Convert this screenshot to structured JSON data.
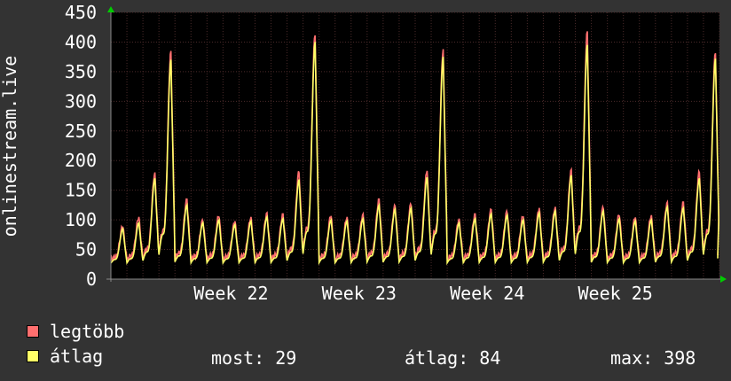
{
  "chart_data": {
    "type": "line",
    "ylabel": "onlinestream.live",
    "ylim": [
      0,
      450
    ],
    "y_ticks": [
      0,
      50,
      100,
      150,
      200,
      250,
      300,
      350,
      400,
      450
    ],
    "x_tick_labels": [
      "Week 22",
      "Week 23",
      "Week 24",
      "Week 25"
    ],
    "grid": true,
    "colors": {
      "background": "#333333",
      "plot": "#000000",
      "grid": "#4a2a2a",
      "axis": "#888888",
      "max": "#ff6f6f",
      "avg": "#ffff66",
      "arrow": "#00cc00"
    },
    "series": [
      {
        "name": "legtöbb",
        "color": "#ff6f6f"
      },
      {
        "name": "átlag",
        "color": "#ffff66"
      }
    ],
    "daily_peaks": [
      {
        "day": 0,
        "max": 90,
        "avg": 85
      },
      {
        "day": 1,
        "max": 105,
        "avg": 95
      },
      {
        "day": 2,
        "max": 180,
        "avg": 170
      },
      {
        "day": 3,
        "max": 385,
        "avg": 370
      },
      {
        "day": 4,
        "max": 135,
        "avg": 125
      },
      {
        "day": 5,
        "max": 100,
        "avg": 95
      },
      {
        "day": 6,
        "max": 108,
        "avg": 100
      },
      {
        "day": 7,
        "max": 98,
        "avg": 92
      },
      {
        "day": 8,
        "max": 105,
        "avg": 98
      },
      {
        "day": 9,
        "max": 112,
        "avg": 105
      },
      {
        "day": 10,
        "max": 110,
        "avg": 102
      },
      {
        "day": 11,
        "max": 182,
        "avg": 168
      },
      {
        "day": 12,
        "max": 415,
        "avg": 400
      },
      {
        "day": 13,
        "max": 108,
        "avg": 100
      },
      {
        "day": 14,
        "max": 105,
        "avg": 98
      },
      {
        "day": 15,
        "max": 110,
        "avg": 102
      },
      {
        "day": 16,
        "max": 135,
        "avg": 125
      },
      {
        "day": 17,
        "max": 125,
        "avg": 118
      },
      {
        "day": 18,
        "max": 128,
        "avg": 120
      },
      {
        "day": 19,
        "max": 185,
        "avg": 172
      },
      {
        "day": 20,
        "max": 388,
        "avg": 375
      },
      {
        "day": 21,
        "max": 102,
        "avg": 95
      },
      {
        "day": 22,
        "max": 110,
        "avg": 102
      },
      {
        "day": 23,
        "max": 118,
        "avg": 110
      },
      {
        "day": 24,
        "max": 115,
        "avg": 108
      },
      {
        "day": 25,
        "max": 108,
        "avg": 100
      },
      {
        "day": 26,
        "max": 120,
        "avg": 112
      },
      {
        "day": 27,
        "max": 122,
        "avg": 115
      },
      {
        "day": 28,
        "max": 185,
        "avg": 175
      },
      {
        "day": 29,
        "max": 418,
        "avg": 395
      },
      {
        "day": 30,
        "max": 122,
        "avg": 115
      },
      {
        "day": 31,
        "max": 110,
        "avg": 102
      },
      {
        "day": 32,
        "max": 105,
        "avg": 98
      },
      {
        "day": 33,
        "max": 108,
        "avg": 100
      },
      {
        "day": 34,
        "max": 130,
        "avg": 122
      },
      {
        "day": 35,
        "max": 130,
        "avg": 120
      },
      {
        "day": 36,
        "max": 182,
        "avg": 170
      },
      {
        "day": 37,
        "max": 385,
        "avg": 372
      },
      {
        "day": 38,
        "max": 40,
        "avg": 35
      }
    ]
  },
  "legend": {
    "max_label": "legtöbb",
    "avg_label": "átlag",
    "now_text": "most: 29",
    "avg_text": "átlag: 84",
    "max_text": "max: 398"
  }
}
